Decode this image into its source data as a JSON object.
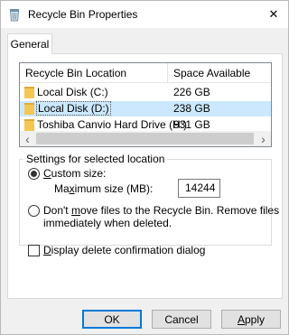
{
  "window": {
    "title": "Recycle Bin Properties",
    "close_glyph": "✕"
  },
  "tabs": [
    {
      "label": "General",
      "selected": true
    }
  ],
  "list": {
    "columns": [
      "Recycle Bin Location",
      "Space Available"
    ],
    "rows": [
      {
        "name": "Local Disk (C:)",
        "space": "226 GB",
        "selected": false
      },
      {
        "name": "Local Disk (D:)",
        "space": "238 GB",
        "selected": true
      },
      {
        "name": "Toshiba Canvio Hard Drive (H:)",
        "space": "931 GB",
        "selected": false
      }
    ],
    "scroll_left_glyph": "‹",
    "scroll_right_glyph": "›"
  },
  "settings": {
    "legend": "Settings for selected location",
    "custom_size": {
      "label_prefix": "C",
      "label_rest": "ustom size:",
      "checked": true
    },
    "max_size": {
      "label_prefix": "Ma",
      "label_underline": "x",
      "label_rest": "imum size (MB):",
      "value": "14244"
    },
    "no_move": {
      "line1_prefix": "Don't ",
      "line1_underline": "m",
      "line1_rest": "ove files to the Recycle Bin. Remove files",
      "line2": "immediately when deleted.",
      "checked": false
    }
  },
  "confirm": {
    "label_underline": "D",
    "label_rest": "isplay delete confirmation dialog",
    "checked": false
  },
  "buttons": {
    "ok": "OK",
    "cancel": "Cancel",
    "apply_underline": "A",
    "apply_rest": "pply"
  },
  "colors": {
    "selection": "#cce8ff",
    "accent": "#0078d7",
    "folder": "#f4c752"
  }
}
